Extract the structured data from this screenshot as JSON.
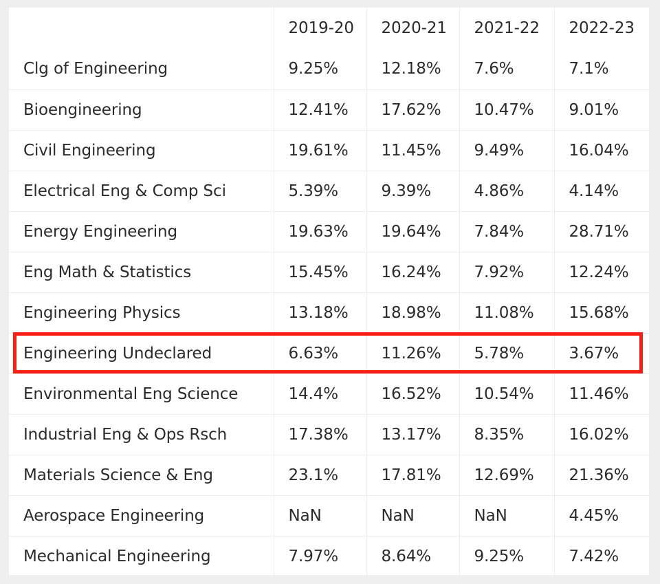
{
  "table": {
    "columns": [
      "",
      "2019-20",
      "2020-21",
      "2021-22",
      "2022-23"
    ],
    "highlighted_row_label": "Engineering Undeclared",
    "highlight_color": "#fb2015",
    "rows": [
      {
        "label": "Clg of Engineering",
        "values": [
          "9.25%",
          "12.18%",
          "7.6%",
          "7.1%"
        ]
      },
      {
        "label": "Bioengineering",
        "values": [
          "12.41%",
          "17.62%",
          "10.47%",
          "9.01%"
        ]
      },
      {
        "label": "Civil Engineering",
        "values": [
          "19.61%",
          "11.45%",
          "9.49%",
          "16.04%"
        ]
      },
      {
        "label": "Electrical Eng & Comp Sci",
        "values": [
          "5.39%",
          "9.39%",
          "4.86%",
          "4.14%"
        ]
      },
      {
        "label": "Energy Engineering",
        "values": [
          "19.63%",
          "19.64%",
          "7.84%",
          "28.71%"
        ]
      },
      {
        "label": "Eng Math & Statistics",
        "values": [
          "15.45%",
          "16.24%",
          "7.92%",
          "12.24%"
        ]
      },
      {
        "label": "Engineering Physics",
        "values": [
          "13.18%",
          "18.98%",
          "11.08%",
          "15.68%"
        ]
      },
      {
        "label": "Engineering Undeclared",
        "values": [
          "6.63%",
          "11.26%",
          "5.78%",
          "3.67%"
        ]
      },
      {
        "label": "Environmental Eng Science",
        "values": [
          "14.4%",
          "16.52%",
          "10.54%",
          "11.46%"
        ]
      },
      {
        "label": "Industrial Eng & Ops Rsch",
        "values": [
          "17.38%",
          "13.17%",
          "8.35%",
          "16.02%"
        ]
      },
      {
        "label": "Materials Science & Eng",
        "values": [
          "23.1%",
          "17.81%",
          "12.69%",
          "21.36%"
        ]
      },
      {
        "label": "Aerospace Engineering",
        "values": [
          "NaN",
          "NaN",
          "NaN",
          "4.45%"
        ]
      },
      {
        "label": "Mechanical Engineering",
        "values": [
          "7.97%",
          "8.64%",
          "9.25%",
          "7.42%"
        ]
      }
    ]
  }
}
